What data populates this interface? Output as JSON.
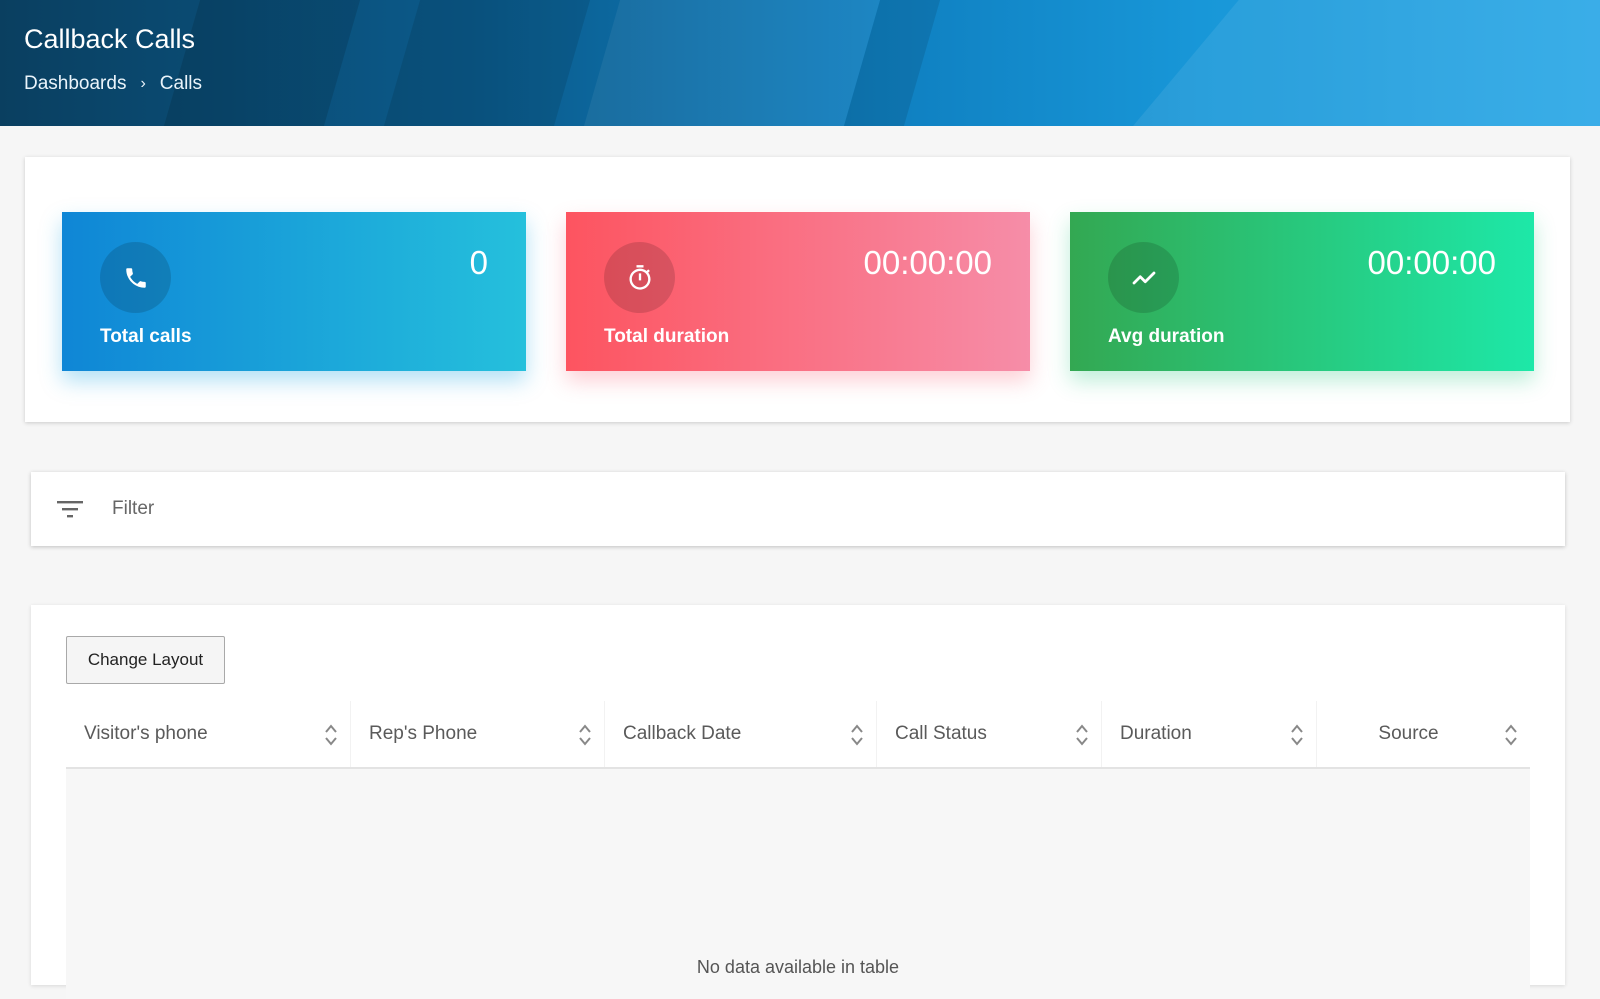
{
  "header": {
    "title": "Callback Calls",
    "breadcrumb": [
      "Dashboards",
      "Calls"
    ],
    "breadcrumb_separator": "›"
  },
  "stats": [
    {
      "label": "Total calls",
      "value": "0",
      "icon": "phone-icon",
      "color": "#1a9fd9"
    },
    {
      "label": "Total duration",
      "value": "00:00:00",
      "icon": "stopwatch-icon",
      "color": "#fb6b7e"
    },
    {
      "label": "Avg duration",
      "value": "00:00:00",
      "icon": "trending-line-icon",
      "color": "#2cc97a"
    }
  ],
  "filter": {
    "label": "Filter",
    "icon": "filter-icon"
  },
  "table": {
    "change_layout_label": "Change Layout",
    "columns": [
      "Visitor's phone",
      "Rep's Phone",
      "Callback Date",
      "Call Status",
      "Duration",
      "Source"
    ],
    "empty_message": "No data available in table"
  }
}
